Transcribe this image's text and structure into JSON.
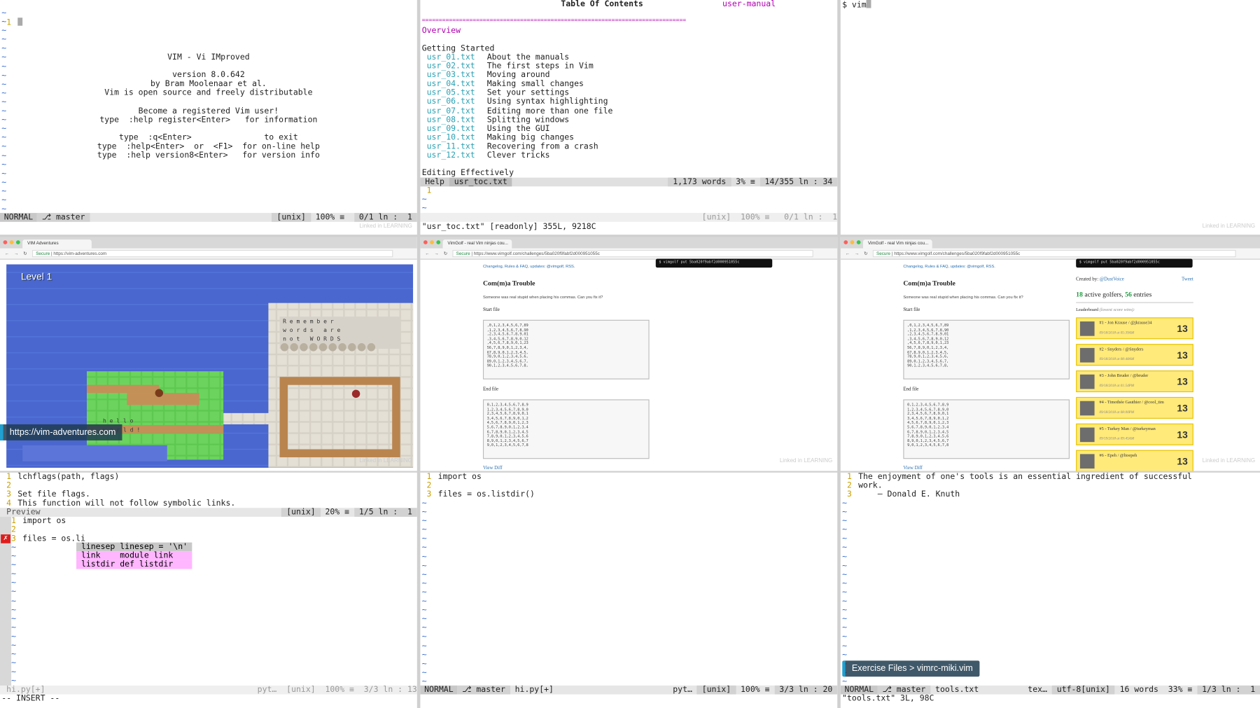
{
  "top_left": {
    "line1": "1",
    "splash": [
      "VIM - Vi IMproved",
      "",
      "version 8.0.642",
      "by Bram Moolenaar et al.",
      "Vim is open source and freely distributable",
      "",
      "Become a registered Vim user!",
      "type  :help register<Enter>   for information",
      "",
      "type  :q<Enter>               to exit",
      "type  :help<Enter>  or  <F1>  for on-line help",
      "type  :help version8<Enter>   for version info"
    ],
    "status": {
      "mode": "NORMAL",
      "branch": "⎇ master",
      "ff": "[unix]",
      "pct": "100% ≡",
      "pos": "0/1 ln :  1"
    }
  },
  "top_middle": {
    "header_title": "Table Of Contents",
    "header_tag": "user-manual",
    "rule": "==============================================================================",
    "overview": "Overview",
    "section": "Getting Started",
    "toc": [
      {
        "file": "usr_01.txt",
        "title": "About the manuals"
      },
      {
        "file": "usr_02.txt",
        "title": "The first steps in Vim"
      },
      {
        "file": "usr_03.txt",
        "title": "Moving around"
      },
      {
        "file": "usr_04.txt",
        "title": "Making small changes"
      },
      {
        "file": "usr_05.txt",
        "title": "Set your settings"
      },
      {
        "file": "usr_06.txt",
        "title": "Using syntax highlighting"
      },
      {
        "file": "usr_07.txt",
        "title": "Editing more than one file"
      },
      {
        "file": "usr_08.txt",
        "title": "Splitting windows"
      },
      {
        "file": "usr_09.txt",
        "title": "Using the GUI"
      },
      {
        "file": "usr_10.txt",
        "title": "Making big changes"
      },
      {
        "file": "usr_11.txt",
        "title": "Recovering from a crash"
      },
      {
        "file": "usr_12.txt",
        "title": "Clever tricks"
      }
    ],
    "section2": "Editing Effectively",
    "help_status": {
      "help": "Help",
      "file": "usr_toc.txt",
      "words": "1,173 words",
      "pct": "3% ≡",
      "pos": "14/355 ln : 34"
    },
    "lower_line": "1",
    "lower_status": {
      "ff": "[unix]",
      "pct": "100% ≡",
      "pos": "0/1 ln :  1"
    },
    "message": "\"usr_toc.txt\" [readonly] 355L, 9218C"
  },
  "top_right": {
    "prompt": "$ vim"
  },
  "browser_left": {
    "tab": "VIM Adventures",
    "url": "https://vim-adventures.com",
    "secure": "Secure",
    "level": "Level 1",
    "words_top": [
      "R e m e m b e r",
      "w o r d s   a r e",
      "n o t   W O R D S"
    ],
    "words_bottom": [
      "h e l l o",
      "w o r l d !"
    ],
    "banner": "https://vim-adventures.com"
  },
  "browser_mid": {
    "tab": "VimGolf - real Vim ninjas cou...",
    "url": "https://www.vimgolf.com/challenges/5ba020f9fabf2d000951055c",
    "secure": "Secure",
    "links": "Changelog, Rules & FAQ, updates: @vimgolf, RSS.",
    "terminal": "$ vimgolf put 5ba020f9abf2d000951055c",
    "title": "Com(m)a Trouble",
    "desc": "Someone was real stupid when placing his commas. Can you fix it?",
    "start_label": "Start file",
    "start_code": ",0,1,2,3,4,5,6,7,89\n,1,2,3,4,5,6,7,8,90\n,2,3,4,5,6,7,8,9,01\n,3,4,5,6,7,8,9,0,12\n,4,5,6,7,8,9,0,1,23\n56,7,8,9,0,1,2,3,4,\n67,8,9,0,1,2,3,4,5,\n78,9,0,1,2,3,4,5,6,\n89,0,1,2,3,4,5,6,7,\n90,1,2,3,4,5,6,7,8,",
    "end_label": "End file",
    "end_code": "0,1,2,3,4,5,6,7,8,9\n1,2,3,4,5,6,7,8,9,0\n2,3,4,5,6,7,8,9,0,1\n3,4,5,6,7,8,9,0,1,2\n4,5,6,7,8,9,0,1,2,3\n5,6,7,8,9,0,1,2,3,4\n6,7,8,9,0,1,2,3,4,5\n7,8,9,0,1,2,3,4,5,6\n8,9,0,1,2,3,4,5,6,7\n9,0,1,2,3,4,5,6,7,8",
    "view_diff": "View Diff"
  },
  "browser_right": {
    "created_by_label": "Created by:",
    "created_by": "@DustVoice",
    "tweet": "Tweet",
    "golfers_num": "18",
    "golfers_text": "active golfers,",
    "entries_num": "56",
    "entries_text": "entries",
    "leaderboard": "Leaderboard",
    "leaderboard_note": "(lowest score wins):",
    "leaders": [
      {
        "name": "#1 - Jon Krause / @jkrause34",
        "date": "09/18/2018 at 05:39AM",
        "score": "13"
      },
      {
        "name": "#2 - Snyders / @Snyders",
        "date": "09/18/2018 at 08:48AM",
        "score": "13"
      },
      {
        "name": "#3 - John Bruder / @bruder",
        "date": "09/18/2018 at 01:54PM",
        "score": "13"
      },
      {
        "name": "#4 - Timothée Gauthier / @cool_tim",
        "date": "09/18/2018 at 08:00PM",
        "score": "13"
      },
      {
        "name": "#5 - Turkey Man / @turkeyman",
        "date": "09/19/2018 at 09:45AM",
        "score": "13"
      },
      {
        "name": "#6 - Epeh / @ltoepeh",
        "date": "",
        "score": "13"
      }
    ]
  },
  "bottom_left": {
    "preview_lines": [
      "lchflags(path, flags)",
      "",
      "Set file flags.",
      "This function will not follow symbolic links."
    ],
    "preview_status": {
      "name": "Preview",
      "ff": "[unix]",
      "pct": "20% ≡",
      "pos": "1/5 ln :  1"
    },
    "code": [
      "import os",
      "",
      "files = os.li"
    ],
    "completions": [
      {
        "word": "linesep",
        "kind": "linesep = '\\n'"
      },
      {
        "word": "link   ",
        "kind": "module link"
      },
      {
        "word": "listdir",
        "kind": "def listdir"
      }
    ],
    "status": {
      "file": "hi.py[+]",
      "ft": "pyt…",
      "ff": "[unix]",
      "pct": "100% ≡",
      "pos": "3/3 ln : 13"
    },
    "message": "-- INSERT --",
    "sign": "✗"
  },
  "bottom_middle": {
    "code": [
      "import os",
      "",
      "files = os.listdir()"
    ],
    "status": {
      "mode": "NORMAL",
      "branch": "⎇ master",
      "file": "hi.py[+]",
      "ft": "pyt…",
      "ff": "[unix]",
      "pct": "100% ≡",
      "pos": "3/3 ln : 20"
    }
  },
  "bottom_right": {
    "code": [
      "The enjoyment of one's tools is an essential ingredient of successful",
      "work.",
      "    – Donald E. Knuth"
    ],
    "banner": "Exercise Files > vimrc-miki.vim",
    "status": {
      "mode": "NORMAL",
      "branch": "⎇ master",
      "file": "tools.txt",
      "ft": "tex…",
      "enc": "utf-8[unix]",
      "words": "16 words",
      "pct": "33% ≡",
      "pos": "1/3 ln :  1"
    },
    "message": "\"tools.txt\" 3L, 98C"
  },
  "watermark": "Linked in LEARNING",
  "colors": {
    "line_number": "#c9a100",
    "tilde": "#3a6fd0",
    "help_link": "#2aa1b3",
    "header_tag": "#b000b0",
    "pmenu": "#ffb6ff",
    "pmenu_sel": "#c8c8c8"
  }
}
